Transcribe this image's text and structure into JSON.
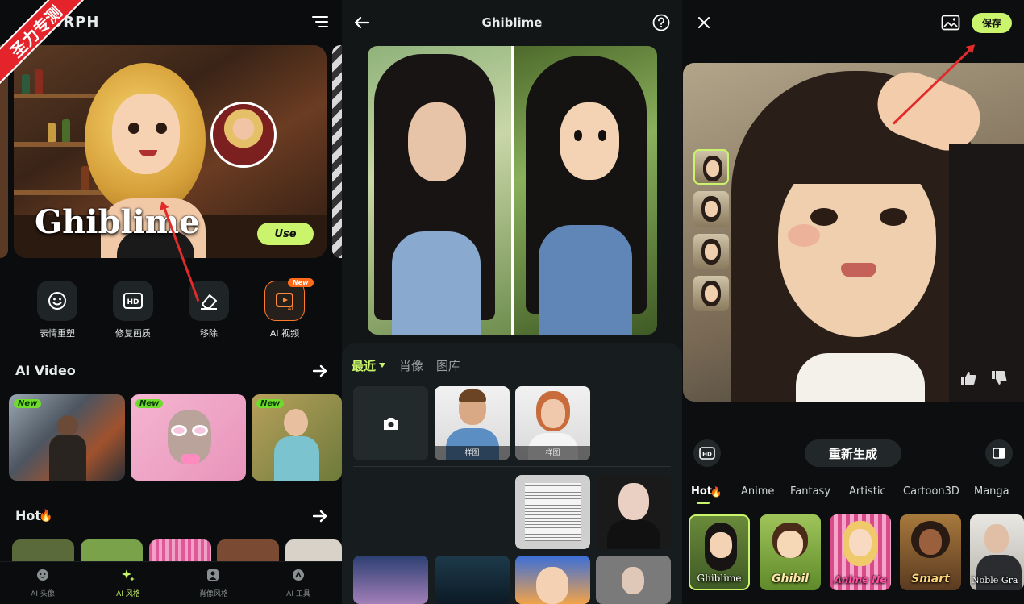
{
  "watermark": "圣力专测",
  "panel1": {
    "brand": "ORPH",
    "hero": {
      "title": "Ghiblime",
      "use_label": "Use"
    },
    "tools": [
      {
        "label": "表情重塑",
        "icon": "face-smile-icon"
      },
      {
        "label": "修复画质",
        "icon": "hd-enhance-icon"
      },
      {
        "label": "移除",
        "icon": "eraser-icon"
      },
      {
        "label": "AI 视频",
        "icon": "ai-video-icon",
        "badge": "New"
      }
    ],
    "ai_video": {
      "title": "AI Video",
      "badges": [
        "New",
        "New",
        "New"
      ]
    },
    "hot": {
      "title": "Hot"
    },
    "nav": [
      {
        "label": "AI 头像",
        "active": false
      },
      {
        "label": "AI 风格",
        "active": true
      },
      {
        "label": "肖像风格",
        "active": false
      },
      {
        "label": "AI 工具",
        "active": false
      }
    ]
  },
  "panel2": {
    "title": "Ghiblime",
    "tabs": [
      "最近",
      "肖像",
      "图库"
    ],
    "samples": [
      "样图",
      "样图"
    ]
  },
  "panel3": {
    "save_label": "保存",
    "regenerate_label": "重新生成",
    "categories": [
      "Hot",
      "Anime",
      "Fantasy",
      "Artistic",
      "Cartoon3D",
      "Manga"
    ],
    "styles": [
      "Ghiblime",
      "Ghibil",
      "Anime Ne",
      "Smart",
      "Noble Gra"
    ]
  },
  "colors": {
    "accent": "#c9f46b",
    "new_badge": "#6fdc2c",
    "hot_badge": "#ff6a1a",
    "annotation": "#e12a2a"
  }
}
